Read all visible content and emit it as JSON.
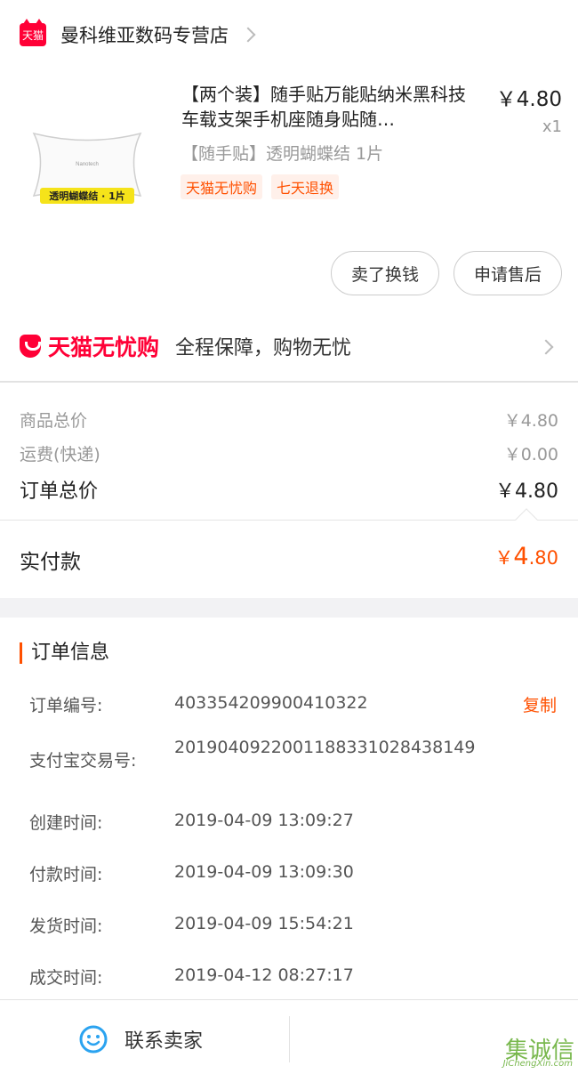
{
  "store": {
    "logo_text": "天猫",
    "name": "曼科维亚数码专营店"
  },
  "product": {
    "title": "【两个装】随手贴万能贴纳米黑科技 车载支架手机座随身贴随…",
    "sku": "【随手贴】透明蝴蝶结 1片",
    "price": "￥4.80",
    "quantity": "x1",
    "image_caption": "透明蝴蝶结 · 1片",
    "tags": [
      "天猫无忧购",
      "七天退换"
    ]
  },
  "actions": {
    "sell_back": "卖了换钱",
    "after_sales": "申请售后"
  },
  "guarantee": {
    "brand": "天猫无忧购",
    "text": "全程保障，购物无忧"
  },
  "summary": {
    "goods_total_label": "商品总价",
    "goods_total": "￥4.80",
    "shipping_label": "运费(快递)",
    "shipping": "￥0.00",
    "order_total_label": "订单总价",
    "order_total": "￥4.80",
    "paid_label": "实付款",
    "paid_currency": "￥",
    "paid_int": "4",
    "paid_dec": ".80"
  },
  "order_info": {
    "title": "订单信息",
    "copy_label": "复制",
    "rows": [
      {
        "label": "订单编号:",
        "value": "403354209900410322"
      },
      {
        "label": "支付宝交易号:",
        "value": "2019040922001188331028438149"
      },
      {
        "label": "创建时间:",
        "value": "2019-04-09 13:09:27"
      },
      {
        "label": "付款时间:",
        "value": "2019-04-09 13:09:30"
      },
      {
        "label": "发货时间:",
        "value": "2019-04-09 15:54:21"
      },
      {
        "label": "成交时间:",
        "value": "2019-04-12 08:27:17"
      }
    ]
  },
  "bottom": {
    "contact_seller": "联系卖家"
  },
  "watermark": {
    "brand": "集诚信",
    "url": "JiChengXin.com"
  },
  "colors": {
    "tmall_red": "#ff0036",
    "accent_orange": "#ff5000",
    "contact_blue": "#2ba3f0"
  }
}
